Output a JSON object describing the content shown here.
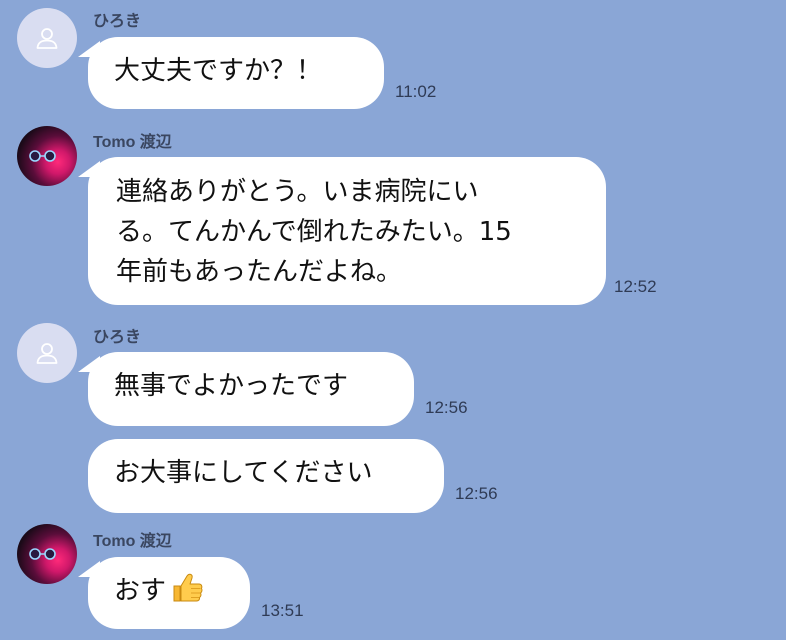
{
  "messages": [
    {
      "sender": "ひろき",
      "avatar": "default-user-icon",
      "text_lines": [
        "大丈夫ですか？！"
      ],
      "time": "11:02"
    },
    {
      "sender": "Tomo 渡辺",
      "avatar": "profile-photo",
      "text_lines": [
        "連絡ありがとう。いま病院にい",
        "る。てんかんで倒れたみたい。15",
        "年前もあったんだよね。"
      ],
      "time": "12:52"
    },
    {
      "sender": "ひろき",
      "avatar": "default-user-icon",
      "text_lines": [
        "無事でよかったです"
      ],
      "time": "12:56"
    },
    {
      "sender": "",
      "avatar": "",
      "text_lines": [
        "お大事にしてください"
      ],
      "time": "12:56"
    },
    {
      "sender": "Tomo 渡辺",
      "avatar": "profile-photo",
      "text_lines": [
        "おす"
      ],
      "emoji": "thumbs-up-icon",
      "time": "13:51"
    }
  ],
  "colors": {
    "background": "#8aa6d6",
    "bubble": "#ffffff",
    "default_avatar_bg": "#d9ddf1",
    "sender_name": "#3a4660",
    "timestamp": "#2f3b55"
  }
}
